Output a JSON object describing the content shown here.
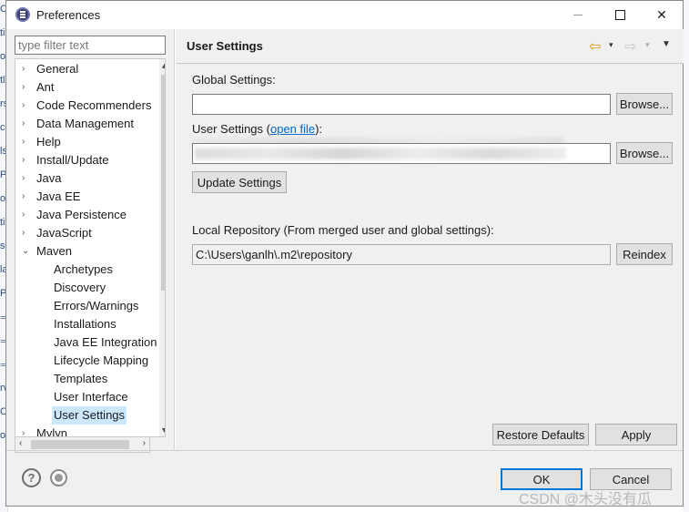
{
  "window": {
    "title": "Preferences",
    "minimize_glyph": "",
    "close_glyph": "✕"
  },
  "sidebar": {
    "filter_placeholder": "type filter text",
    "items": [
      {
        "label": "General",
        "arrow": "›",
        "child": false
      },
      {
        "label": "Ant",
        "arrow": "›",
        "child": false
      },
      {
        "label": "Code Recommenders",
        "arrow": "›",
        "child": false
      },
      {
        "label": "Data Management",
        "arrow": "›",
        "child": false
      },
      {
        "label": "Help",
        "arrow": "›",
        "child": false
      },
      {
        "label": "Install/Update",
        "arrow": "›",
        "child": false
      },
      {
        "label": "Java",
        "arrow": "›",
        "child": false
      },
      {
        "label": "Java EE",
        "arrow": "›",
        "child": false
      },
      {
        "label": "Java Persistence",
        "arrow": "›",
        "child": false
      },
      {
        "label": "JavaScript",
        "arrow": "›",
        "child": false
      },
      {
        "label": "Maven",
        "arrow": "⌄",
        "child": false
      },
      {
        "label": "Archetypes",
        "arrow": "",
        "child": true
      },
      {
        "label": "Discovery",
        "arrow": "",
        "child": true
      },
      {
        "label": "Errors/Warnings",
        "arrow": "",
        "child": true
      },
      {
        "label": "Installations",
        "arrow": "",
        "child": true
      },
      {
        "label": "Java EE Integration",
        "arrow": "",
        "child": true
      },
      {
        "label": "Lifecycle Mapping",
        "arrow": "",
        "child": true
      },
      {
        "label": "Templates",
        "arrow": "",
        "child": true
      },
      {
        "label": "User Interface",
        "arrow": "",
        "child": true
      },
      {
        "label": "User Settings",
        "arrow": "",
        "child": true,
        "selected": true
      },
      {
        "label": "Mylyn",
        "arrow": "›",
        "child": false
      }
    ],
    "scroll_up": "▴",
    "scroll_down": "▾",
    "scroll_left": "‹",
    "scroll_right": "›"
  },
  "page": {
    "title": "User Settings",
    "nav_back": "⇦",
    "nav_back_drop": "▾",
    "nav_forward": "⇨",
    "nav_forward_drop": "▾",
    "view_menu": "▼",
    "global_settings_label": "Global Settings:",
    "global_settings_value": "",
    "browse_label": "Browse...",
    "user_settings_label_prefix": "User Settings (",
    "user_settings_link": "open file",
    "user_settings_label_suffix": "):",
    "update_settings_label": "Update Settings",
    "local_repo_label": "Local Repository (From merged user and global settings):",
    "local_repo_value": "C:\\Users\\ganlh\\.m2\\repository",
    "reindex_label": "Reindex",
    "restore_defaults_label": "Restore Defaults",
    "apply_label": "Apply"
  },
  "footer": {
    "help_glyph": "?",
    "ok_label": "OK",
    "cancel_label": "Cancel"
  },
  "background": {
    "left_glyphs": [
      "C",
      "ti",
      "o",
      "tl",
      "rs",
      "c",
      "ls",
      "P",
      "o",
      "ti",
      "s",
      "la",
      "P",
      "⇒",
      "⇒",
      "⇒",
      "rv",
      "Co",
      "o"
    ]
  },
  "watermark": "CSDN @木头没有瓜"
}
